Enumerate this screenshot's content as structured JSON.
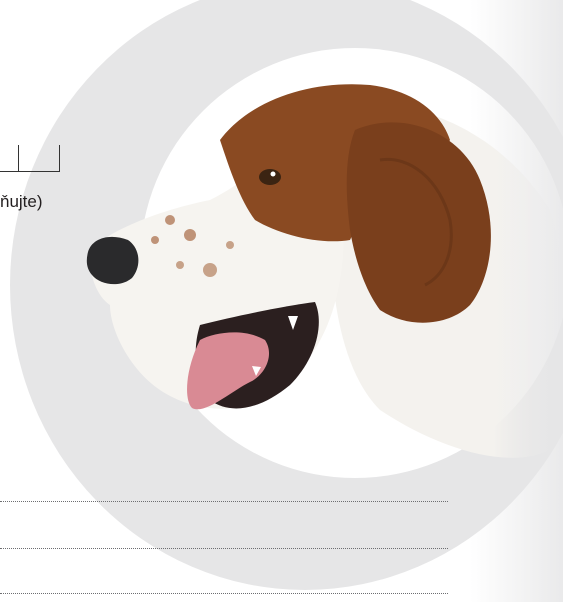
{
  "form": {
    "instruction_fragment": "ňujte)",
    "writing_lines": 3
  },
  "illustration": {
    "subject": "dog-head-profile",
    "colors": {
      "circle": "#e6e6e7",
      "fur_brown": "#8a4a22",
      "fur_white": "#f4f2ee",
      "nose": "#2a2a2c",
      "tongue": "#d98a94"
    }
  }
}
